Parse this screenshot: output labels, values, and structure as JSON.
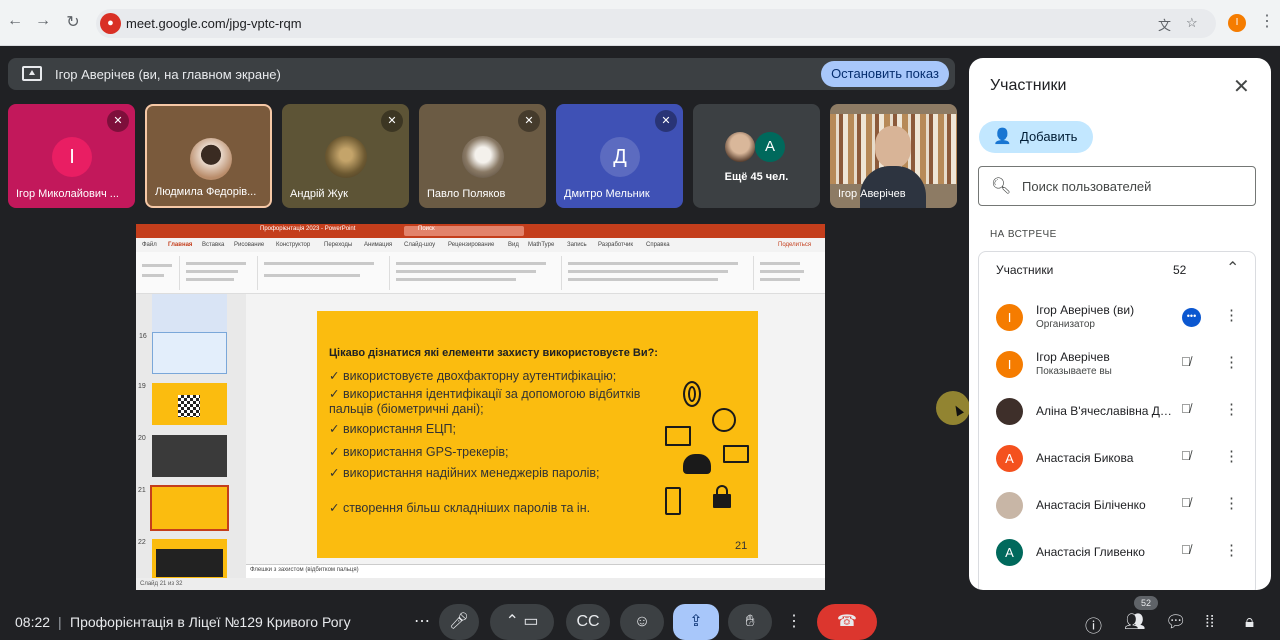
{
  "browser": {
    "url": "meet.google.com/jpg-vptc-rqm",
    "profile_initial": "I"
  },
  "presenting_bar": {
    "text": "Ігор Аверічев (ви, на главном экране)",
    "stop_label": "Остановить показ"
  },
  "tiles": [
    {
      "name": "Ігор Миколайович ...",
      "initial": "I",
      "color": "#e91e63",
      "bg": "#c2185b",
      "muted": true
    },
    {
      "name": "Людмила Федорів...",
      "initial": "",
      "color": "",
      "bg": "#7a5a3c",
      "muted": false
    },
    {
      "name": "Андрій Жук",
      "initial": "",
      "color": "",
      "bg": "#5d5436",
      "muted": true
    },
    {
      "name": "Павло Поляков",
      "initial": "",
      "color": "",
      "bg": "#6b5b44",
      "muted": true
    },
    {
      "name": "Дмитро Мельник",
      "initial": "Д",
      "color": "#5c6bc0",
      "bg": "#3f51b5",
      "muted": true
    },
    {
      "name": "Ещё 45 чел.",
      "initial": "A",
      "color": "#00695c",
      "bg": "#3c4043",
      "muted": false
    },
    {
      "name": "Ігор Аверічев",
      "initial": "",
      "color": "",
      "bg": "#8d7b64",
      "muted": false
    }
  ],
  "powerpoint": {
    "file_title": "Профорієнтація 2023 - PowerPoint",
    "search_placeholder": "Поиск",
    "tabs": [
      "Файл",
      "Главная",
      "Вставка",
      "Рисование",
      "Конструктор",
      "Переходы",
      "Анимация",
      "Слайд-шоу",
      "Рецензирование",
      "Вид",
      "MathType",
      "Запись",
      "Разработчик",
      "Справка"
    ],
    "share_label": "Поделиться",
    "thumb_numbers": [
      "16",
      "19",
      "20",
      "21",
      "22"
    ],
    "notes_text": "Флешки з захистом (відбитком пальця)",
    "status_text": "Слайд 21 из 32"
  },
  "slide": {
    "heading": "Цікаво дізнатися які елементи захисту використовуєте Ви?:",
    "bullets": [
      "✓ використовуєте двохфакторну аутентифікацію;",
      "✓ використання ідентифікації за допомогою відбитків пальців (біометричні дані);",
      "✓ використання ЕЦП;",
      "✓ використання GPS-трекерів;",
      "✓ використання надійних менеджерів паролів;",
      "✓ створення більш складніших паролів та ін."
    ],
    "page_number": "21"
  },
  "participants_panel": {
    "title": "Участники",
    "add_label": "Добавить",
    "search_placeholder": "Поиск пользователей",
    "section_label": "НА ВСТРЕЧЕ",
    "group_label": "Участники",
    "group_count": "52",
    "people": [
      {
        "name": "Ігор Аверічев (ви)",
        "sub": "Организатор",
        "initial": "I",
        "color": "#f57c00",
        "state": "speaking"
      },
      {
        "name": "Ігор Аверічев",
        "sub": "Показываете вы",
        "initial": "I",
        "color": "#f57c00",
        "state": "muted"
      },
      {
        "name": "Аліна В'ячеславівна Де...",
        "sub": "",
        "initial": "",
        "color": "#3e2f2a",
        "state": "muted"
      },
      {
        "name": "Анастасія Бикова",
        "sub": "",
        "initial": "A",
        "color": "#f4511e",
        "state": "muted"
      },
      {
        "name": "Анастасія Біліченко",
        "sub": "",
        "initial": "",
        "color": "#c8b6a6",
        "state": "muted"
      },
      {
        "name": "Анастасія Гливенко",
        "sub": "",
        "initial": "A",
        "color": "#00695c",
        "state": "muted"
      }
    ]
  },
  "bottom_bar": {
    "time": "08:22",
    "meeting_title": "Профорієнтація в Ліцеї №129 Кривого Рогу",
    "participants_badge": "52"
  }
}
